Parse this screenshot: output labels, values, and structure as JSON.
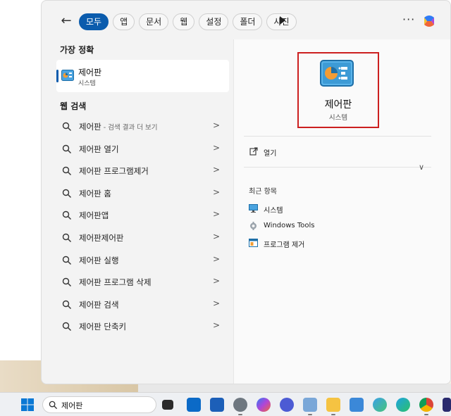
{
  "search_filters": {
    "tabs": [
      {
        "label": "모두",
        "active": true
      },
      {
        "label": "앱"
      },
      {
        "label": "문서"
      },
      {
        "label": "웹"
      },
      {
        "label": "설정"
      },
      {
        "label": "폴더"
      },
      {
        "label": "사진"
      }
    ],
    "more_label": "···"
  },
  "best_match": {
    "section_title": "가장 정확",
    "name": "제어판",
    "subtitle": "시스템"
  },
  "web_search": {
    "section_title": "웹 검색",
    "items": [
      {
        "label": "제어판",
        "hint": " - 검색 결과 더 보기"
      },
      {
        "label": "제어판 열기",
        "hint": ""
      },
      {
        "label": "제어판 프로그램제거",
        "hint": ""
      },
      {
        "label": "제어판 홈",
        "hint": ""
      },
      {
        "label": "제어판앱",
        "hint": ""
      },
      {
        "label": "제어판제어판",
        "hint": ""
      },
      {
        "label": "제어판 실행",
        "hint": ""
      },
      {
        "label": "제어판 프로그램 삭제",
        "hint": ""
      },
      {
        "label": "제어판 검색",
        "hint": ""
      },
      {
        "label": "제어판 단축키",
        "hint": ""
      }
    ]
  },
  "detail": {
    "name": "제어판",
    "subtitle": "시스템",
    "open_label": "열기",
    "recent_title": "최근 항목",
    "recent_items": [
      {
        "label": "시스템",
        "icon": "system-icon"
      },
      {
        "label": "Windows Tools",
        "icon": "windows-tools-icon"
      },
      {
        "label": "프로그램 제거",
        "icon": "uninstall-program-icon"
      }
    ]
  },
  "taskbar": {
    "search_value": "제어판",
    "icons": [
      "task-view-icon",
      "outlook-icon",
      "store-icon",
      "settings-icon",
      "copilot-icon",
      "camera-icon",
      "notepad-icon",
      "file-explorer-icon",
      "notes-icon",
      "paint-icon",
      "edge-icon",
      "chrome-icon",
      "powershell-icon"
    ]
  },
  "colors": {
    "accent": "#0b5cad",
    "highlight_border": "#cc1f1f"
  }
}
